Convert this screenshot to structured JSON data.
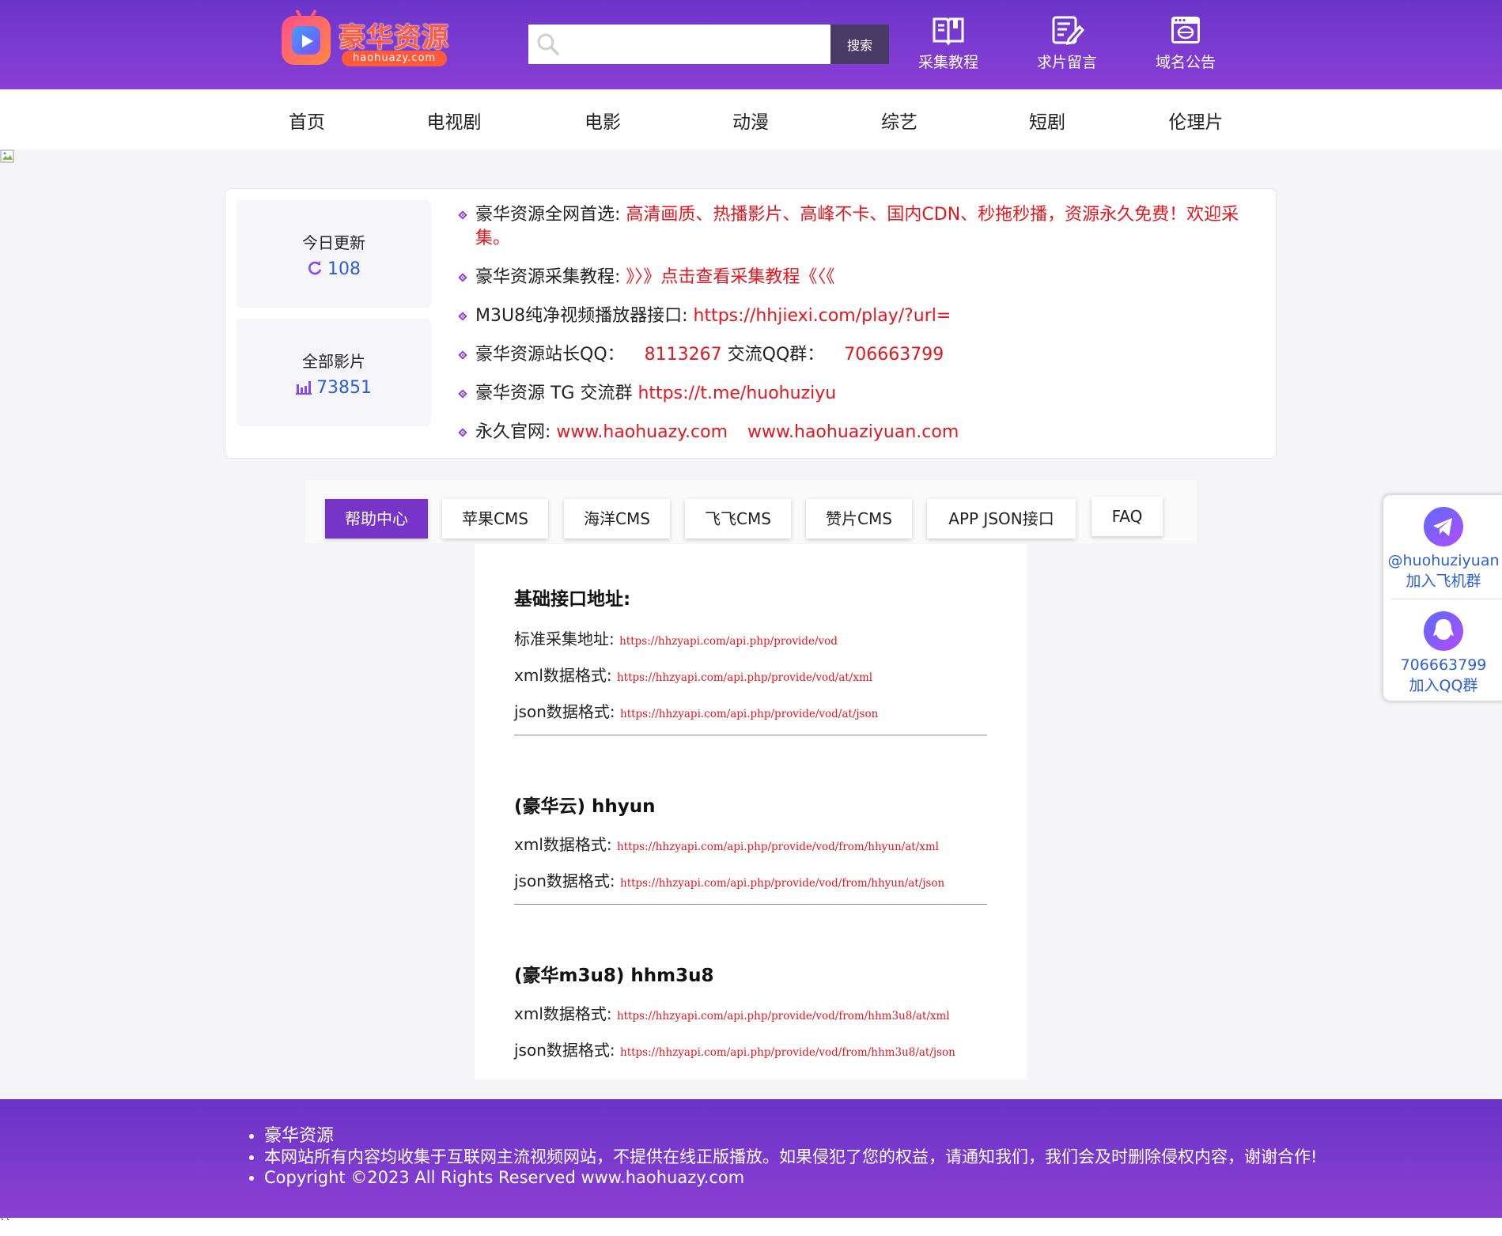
{
  "header": {
    "logo_name": "豪华资源",
    "logo_domain": "haohuazy.com",
    "search_placeholder": "",
    "search_button": "搜索",
    "quick_links": [
      {
        "label": "采集教程",
        "icon": "book-icon"
      },
      {
        "label": "求片留言",
        "icon": "edit-note-icon"
      },
      {
        "label": "域名公告",
        "icon": "browser-window-icon"
      }
    ]
  },
  "nav": [
    "首页",
    "电视剧",
    "电影",
    "动漫",
    "综艺",
    "短剧",
    "伦理片"
  ],
  "stats": {
    "today_label": "今日更新",
    "today_value": "108",
    "total_label": "全部影片",
    "total_value": "73851"
  },
  "notices": {
    "n1_label": "豪华资源全网首选:",
    "n1_text": "高清画质、热播影片、高峰不卡、国内CDN、秒拖秒播，资源永久免费！欢迎采集。",
    "n2_label": "豪华资源采集教程:",
    "n2_link": "》〉》点击查看采集教程《〈《",
    "n3_label": "M3U8纯净视频播放器接口:",
    "n3_link": "https://hhjiexi.com/play/?url=",
    "n4_label": "豪华资源站长QQ：",
    "n4_qq": "8113267",
    "n4_group_label": "交流QQ群：",
    "n4_group": "706663799",
    "n5_label": "豪华资源 TG 交流群",
    "n5_link": "https://t.me/huohuziyu",
    "n6_label": "永久官网:",
    "n6_link1": "www.haohuazy.com",
    "n6_link2": "www.haohuaziyuan.com"
  },
  "tabs": [
    "帮助中心",
    "苹果CMS",
    "海洋CMS",
    "飞飞CMS",
    "赞片CMS",
    "APP JSON接口",
    "FAQ"
  ],
  "active_tab": "帮助中心",
  "sections": {
    "base_title": "基础接口地址:",
    "base_std_label": "标准采集地址:",
    "base_std_url": "https://hhzyapi.com/api.php/provide/vod",
    "base_xml_label": "xml数据格式:",
    "base_xml_url": "https://hhzyapi.com/api.php/provide/vod/at/xml",
    "base_json_label": "json数据格式:",
    "base_json_url": "https://hhzyapi.com/api.php/provide/vod/at/json",
    "hhyun_title": "(豪华云) hhyun",
    "hhyun_xml_label": "xml数据格式:",
    "hhyun_xml_url": "https://hhzyapi.com/api.php/provide/vod/from/hhyun/at/xml",
    "hhyun_json_label": "json数据格式:",
    "hhyun_json_url": "https://hhzyapi.com/api.php/provide/vod/from/hhyun/at/json",
    "hhm3u8_title": "(豪华m3u8) hhm3u8",
    "hhm3u8_xml_label": "xml数据格式:",
    "hhm3u8_xml_url": "https://hhzyapi.com/api.php/provide/vod/from/hhm3u8/at/xml",
    "hhm3u8_json_label": "json数据格式:",
    "hhm3u8_json_url": "https://hhzyapi.com/api.php/provide/vod/from/hhm3u8/at/json"
  },
  "float": {
    "tg_value": "@huohuziyuan",
    "tg_label": "加入飞机群",
    "qq_value": "706663799",
    "qq_label": "加入QQ群"
  },
  "footer": {
    "line1": "豪华资源",
    "line2": "本网站所有内容均收集于互联网主流视频网站，不提供在线正版播放。如果侵犯了您的权益，请通知我们，我们会及时删除侵权内容，谢谢合作!",
    "line3": "Copyright ©2023 All Rights Reserved www.haohuazy.com"
  },
  "tail_text": "``",
  "colors": {
    "header": "#6b35c9",
    "accent": "#7634c8",
    "link_red": "#e6161e",
    "value_blue": "#2b5fd9"
  }
}
